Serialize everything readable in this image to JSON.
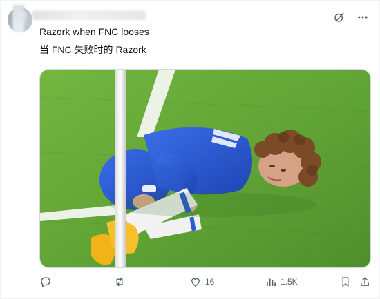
{
  "post": {
    "line1": "Razork when FNC looses",
    "line2": "当 FNC 失败时的 Razork"
  },
  "header": {
    "icons": [
      "grok-icon",
      "more-icon"
    ]
  },
  "actions": {
    "reply_count": "",
    "repost_count": "",
    "like_count": "16",
    "views_count": "1.5K"
  },
  "media": {
    "description_icon": "image-photo",
    "colors": {
      "grass_light": "#6cae3b",
      "grass_dark": "#4e8f2b",
      "jersey": "#2b5bd8",
      "sock": "#f2f2f2"
    }
  }
}
